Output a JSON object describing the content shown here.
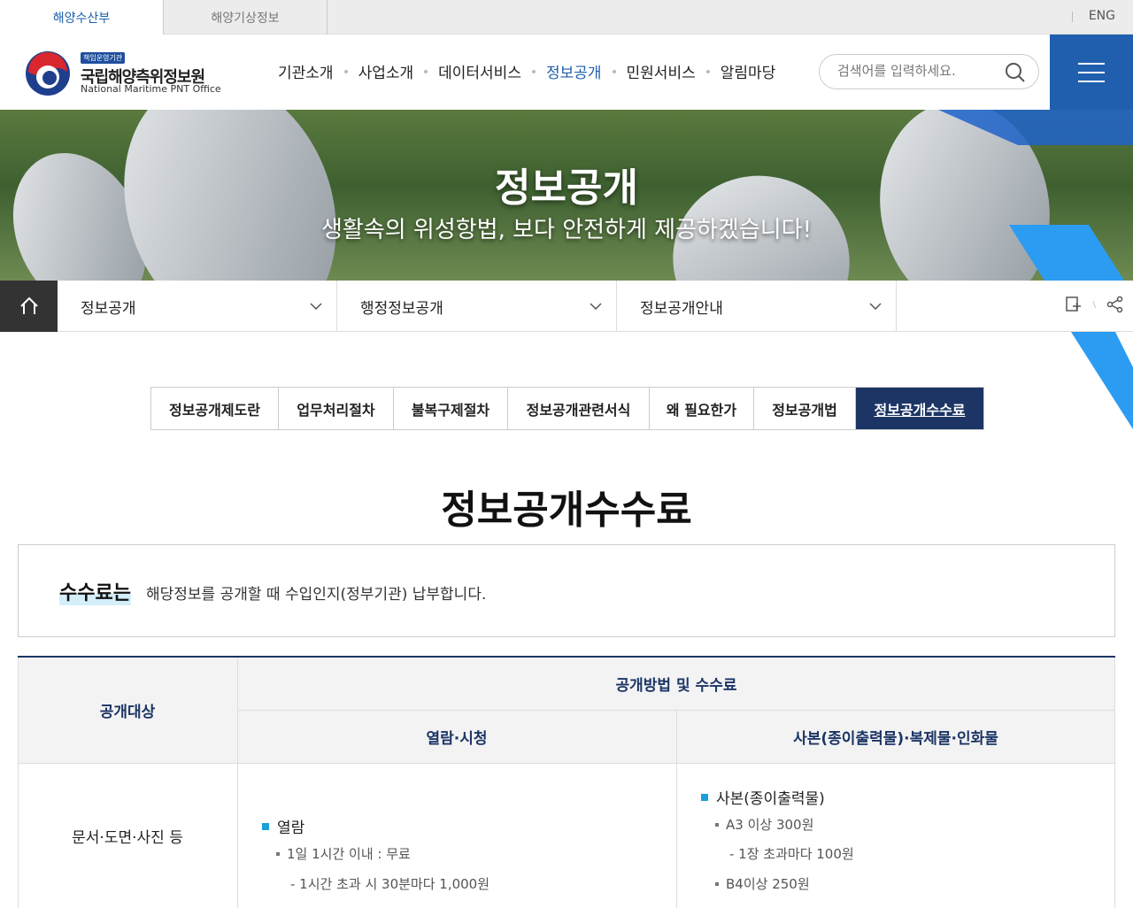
{
  "topbar": {
    "tab_active": "해양수산부",
    "tab_second": "해양기상정보",
    "lang": "ENG"
  },
  "header": {
    "logo_badge": "책임운영기관",
    "logo_ko": "국립해양측위정보원",
    "logo_en": "National Maritime PNT Office",
    "nav": [
      "기관소개",
      "사업소개",
      "데이터서비스",
      "정보공개",
      "민원서비스",
      "알림마당"
    ],
    "nav_active": "정보공개",
    "search_placeholder": "검색어를 입력하세요."
  },
  "hero": {
    "title": "정보공개",
    "subtitle": "생활속의 위성항법, 보다 안전하게 제공하겠습니다!"
  },
  "location": {
    "level1": "정보공개",
    "level2": "행정정보공개",
    "level3": "정보공개안내"
  },
  "subtabs": [
    "정보공개제도란",
    "업무처리절차",
    "불복구제절차",
    "정보공개관련서식",
    "왜 필요한가",
    "정보공개법",
    "정보공개수수료"
  ],
  "subtab_active": "정보공개수수료",
  "page_title": "정보공개수수료",
  "info": {
    "strong": "수수료는",
    "text": "해당정보를 공개할 때 수입인지(정부기관) 납부합니다."
  },
  "table": {
    "head_target": "공개대상",
    "head_method": "공개방법 및 수수료",
    "head_view": "열람·시청",
    "head_copy": "사본(종이출력물)·복제물·인화물",
    "row1_target": "문서·도면·사진 등",
    "view_title": "열람",
    "view_item": "1일 1시간 이내 : 무료",
    "view_sub": "- 1시간 초과 시 30분마다 1,000원",
    "copy_title": "사본(종이출력물)",
    "copy_item1": "A3 이상 300원",
    "copy_sub1": "- 1장 초과마다 100원",
    "copy_item2": "B4이상 250원"
  },
  "colors": {
    "primary": "#1f5fae",
    "navy": "#1c3565",
    "bullet": "#1a9fd9"
  }
}
